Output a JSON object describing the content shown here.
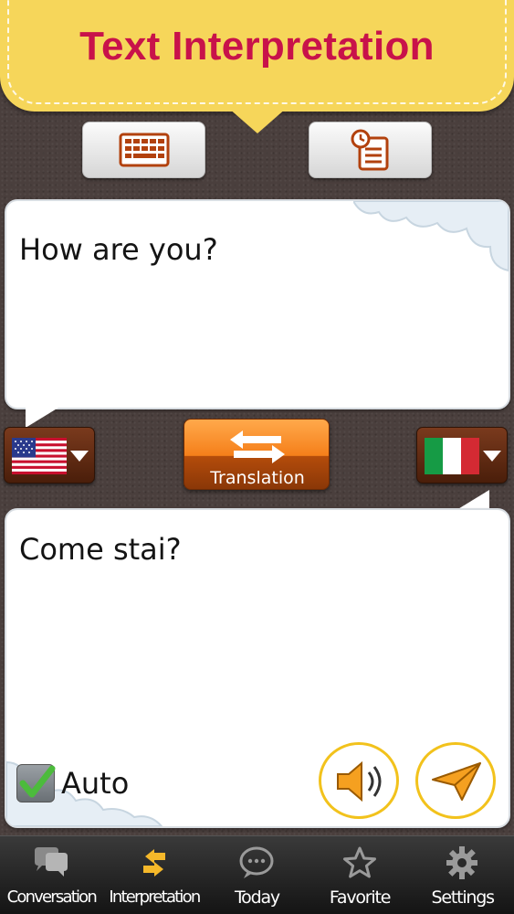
{
  "header": {
    "title": "Text Interpretation"
  },
  "mode_buttons": [
    {
      "icon": "keyboard-icon"
    },
    {
      "icon": "history-clipboard-icon"
    }
  ],
  "source": {
    "text": "How are you?",
    "language_flag": "us-flag-icon"
  },
  "target": {
    "text": "Come stai?",
    "language_flag": "italy-flag-icon"
  },
  "translate_button": {
    "label": "Translation"
  },
  "auto": {
    "label": "Auto",
    "checked": true
  },
  "colors": {
    "header_bg": "#f6d65a",
    "title": "#c8124a",
    "accent_orange": "#f57f1a",
    "ring_yellow": "#f2c21c",
    "active_tab": "#f5b82a"
  },
  "tabs": [
    {
      "label": "Conversation",
      "icon": "conversation-icon",
      "active": false
    },
    {
      "label": "Interpretation",
      "icon": "interpretation-icon",
      "active": true
    },
    {
      "label": "Today",
      "icon": "today-chat-icon",
      "active": false
    },
    {
      "label": "Favorite",
      "icon": "star-icon",
      "active": false
    },
    {
      "label": "Settings",
      "icon": "gear-icon",
      "active": false
    }
  ]
}
